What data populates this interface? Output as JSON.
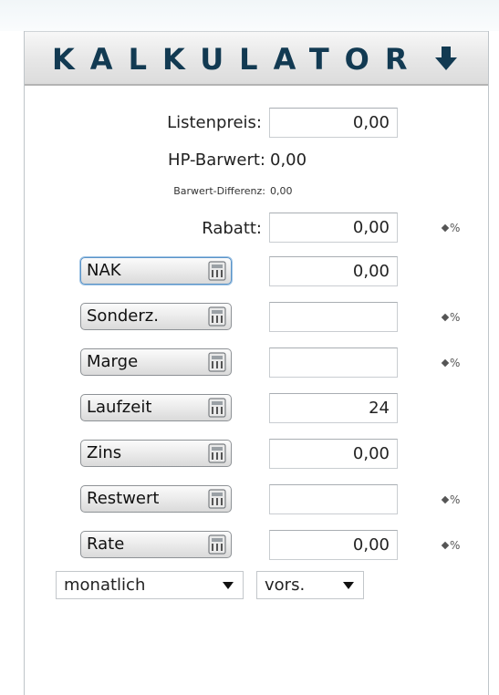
{
  "header": {
    "title": "KALKULATOR",
    "arrow_icon": "arrow-down-icon"
  },
  "fields": {
    "listenpreis": {
      "label": "Listenpreis:",
      "value": "0,00"
    },
    "hp_barwert": {
      "label": "HP-Barwert:",
      "value": "0,00"
    },
    "barwert_differenz": {
      "label": "Barwert-Differenz:",
      "value": "0,00"
    },
    "rabatt": {
      "label": "Rabatt:",
      "value": "0,00"
    }
  },
  "calc_rows": [
    {
      "label": "NAK",
      "value": "0,00",
      "has_percent": false,
      "active": true
    },
    {
      "label": "Sonderz.",
      "value": "",
      "has_percent": true,
      "active": false
    },
    {
      "label": "Marge",
      "value": "",
      "has_percent": true,
      "active": false
    },
    {
      "label": "Laufzeit",
      "value": "24",
      "has_percent": false,
      "active": false
    },
    {
      "label": "Zins",
      "value": "0,00",
      "has_percent": false,
      "active": false
    },
    {
      "label": "Restwert",
      "value": "",
      "has_percent": true,
      "active": false
    },
    {
      "label": "Rate",
      "value": "0,00",
      "has_percent": true,
      "active": false
    }
  ],
  "percent_toggle": {
    "label": "%",
    "icon": "diamond-icon"
  },
  "selects": {
    "interval": {
      "value": "monatlich"
    },
    "timing": {
      "value": "vors."
    }
  },
  "colors": {
    "title": "#123a52",
    "active_button_border": "#5a93c7"
  }
}
